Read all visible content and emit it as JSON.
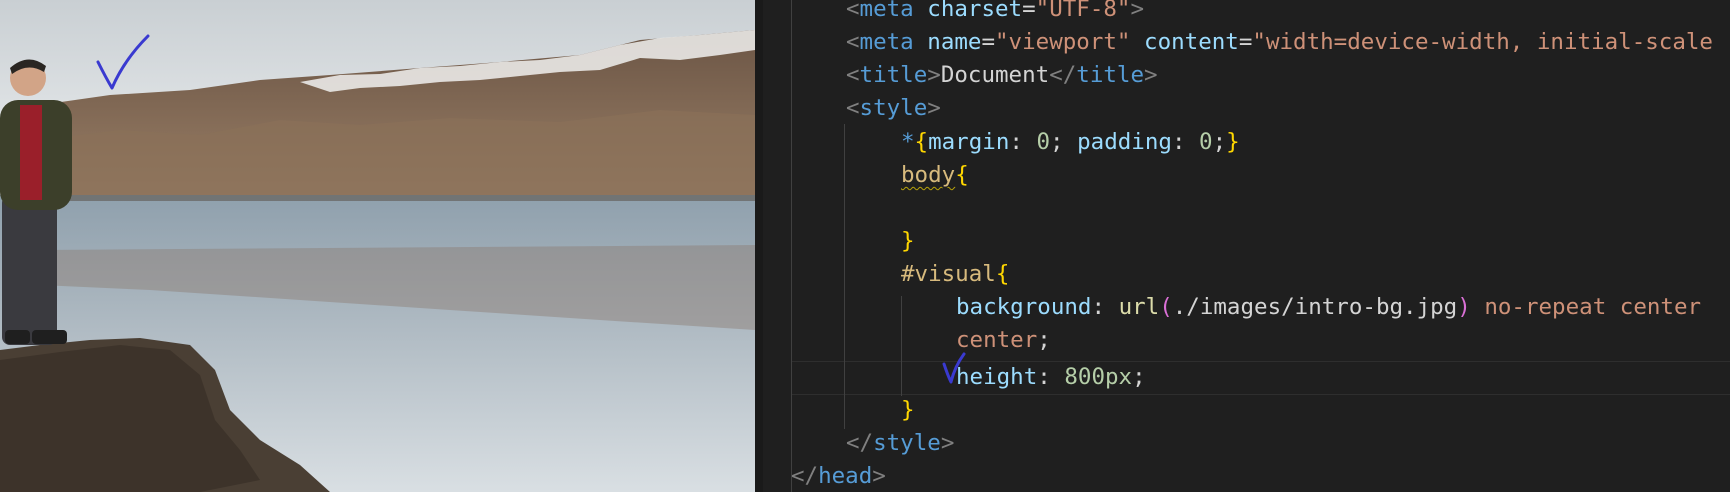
{
  "editor": {
    "lines": [
      {
        "id": "meta-charset",
        "tokens": [
          "<",
          "meta",
          " ",
          "charset",
          "=",
          "\"UTF-8\"",
          ">"
        ]
      },
      {
        "id": "meta-viewport",
        "tokens": [
          "<",
          "meta",
          " ",
          "name",
          "=",
          "\"viewport\"",
          " ",
          "content",
          "=",
          "\"width=device-width, initial-scale"
        ]
      },
      {
        "id": "title",
        "tokens": [
          "<",
          "title",
          ">",
          "Document",
          "</",
          "title",
          ">"
        ]
      },
      {
        "id": "style-open",
        "tokens": [
          "<",
          "style",
          ">"
        ]
      },
      {
        "id": "reset-rule",
        "tokens": [
          "*",
          "{",
          "margin",
          ": ",
          "0",
          "; ",
          "padding",
          ": ",
          "0",
          ";",
          "}"
        ]
      },
      {
        "id": "body-rule-open",
        "tokens": [
          "body",
          "{"
        ]
      },
      {
        "id": "blank",
        "tokens": [
          ""
        ]
      },
      {
        "id": "body-rule-close",
        "tokens": [
          "}"
        ]
      },
      {
        "id": "visual-rule-open",
        "tokens": [
          "#visual",
          "{"
        ]
      },
      {
        "id": "background-decl",
        "tokens": [
          "background",
          ": ",
          "url",
          "(",
          "./images/intro-bg.jpg",
          ")",
          " ",
          "no-repeat center"
        ]
      },
      {
        "id": "background-wrap",
        "tokens": [
          "center",
          ";"
        ]
      },
      {
        "id": "height-decl",
        "tokens": [
          "height",
          ": ",
          "800px",
          ";"
        ]
      },
      {
        "id": "visual-rule-close",
        "tokens": [
          "}"
        ]
      },
      {
        "id": "style-close",
        "tokens": [
          "</",
          "style",
          ">"
        ]
      },
      {
        "id": "head-close",
        "tokens": [
          "</",
          "head",
          ">"
        ]
      }
    ]
  },
  "photo": {
    "description_icon": "landscape-photo",
    "sky_color": "#dfe3e6",
    "water_color": "#b9c4cc",
    "mountain_color": "#7a6351"
  },
  "annotations": {
    "pen_color": "#3a3ad0",
    "marks": [
      "checkmark-photo",
      "checkmark-code"
    ]
  }
}
